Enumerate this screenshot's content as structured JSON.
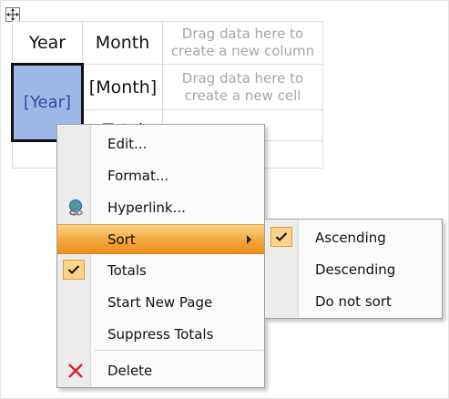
{
  "grid": {
    "headers": [
      "Year",
      "Month"
    ],
    "column_hint": "Drag data here to create a new column",
    "row_cells": [
      "[Year]",
      "[Month]"
    ],
    "cell_hint": "Drag data here to create a new cell",
    "partial_text": "Total"
  },
  "context_menu": {
    "items": [
      {
        "label": "Edit...",
        "icon": "none"
      },
      {
        "label": "Format...",
        "icon": "none"
      },
      {
        "label": "Hyperlink...",
        "icon": "globe-link-icon"
      },
      {
        "label": "Sort",
        "icon": "none",
        "has_submenu": true,
        "highlighted": true
      },
      {
        "label": "Totals",
        "icon": "checkmark-icon",
        "checked": true
      },
      {
        "label": "Start New Page",
        "icon": "none"
      },
      {
        "label": "Suppress Totals",
        "icon": "none"
      },
      {
        "label": "Delete",
        "icon": "delete-x-icon"
      }
    ]
  },
  "sort_submenu": {
    "items": [
      {
        "label": "Ascending",
        "checked": true
      },
      {
        "label": "Descending",
        "checked": false
      },
      {
        "label": "Do not sort",
        "checked": false
      }
    ]
  },
  "colors": {
    "highlight": "#f4a63a",
    "selected_cell": "#9eb8e6",
    "delete": "#d9262a"
  }
}
